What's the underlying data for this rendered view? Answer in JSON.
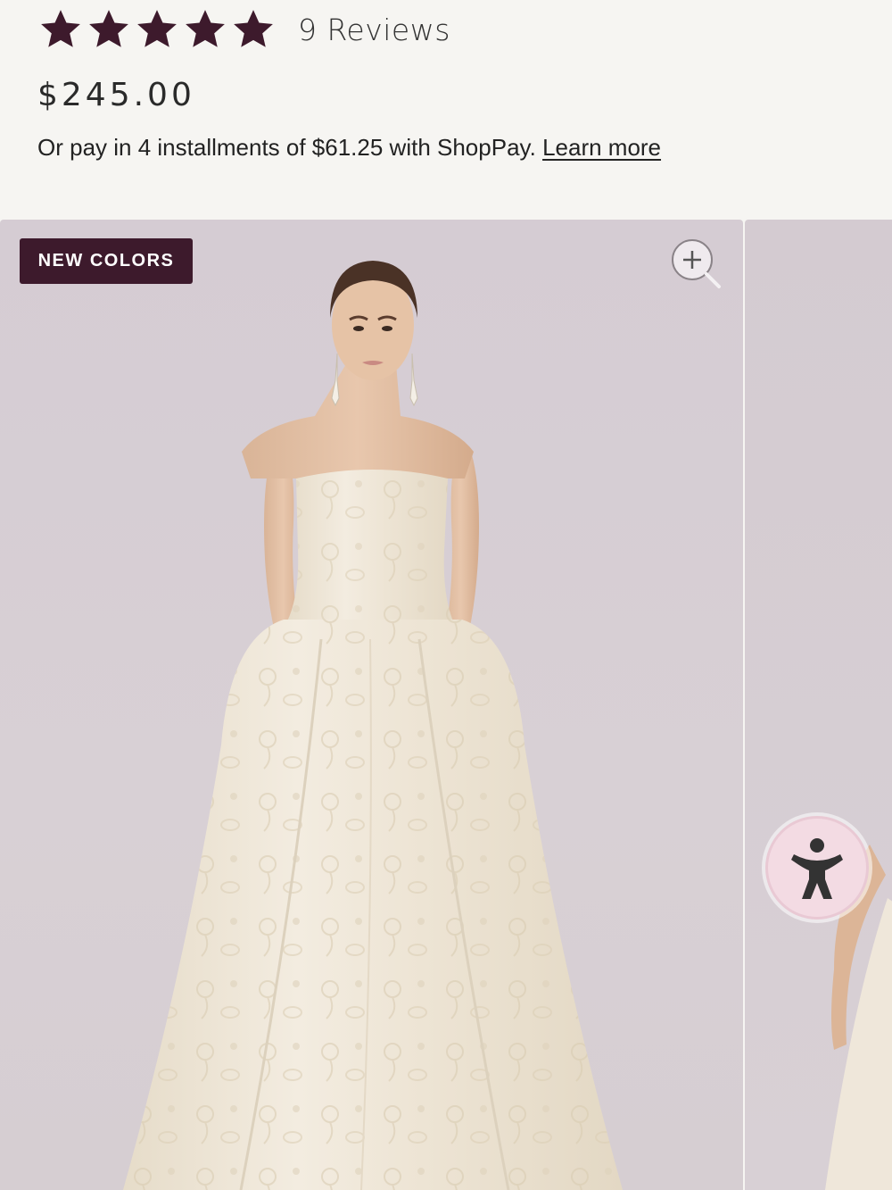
{
  "product": {
    "rating": 5,
    "reviews_label": "9 Reviews",
    "price": "$245.00",
    "installments_text": "Or pay in 4 installments of $61.25 with ShopPay.",
    "learn_more_label": "Learn more"
  },
  "gallery": {
    "badge_label": "NEW COLORS",
    "zoom_icon": "zoom-in-icon",
    "main_image_alt": "Model wearing strapless ivory floral jacquard ball gown",
    "accessibility_icon": "accessibility-icon"
  },
  "colors": {
    "star": "#3d1a2c",
    "badge_bg": "#3d1a2c",
    "page_bg": "#f6f5f2",
    "image_bg": "#d6ced3",
    "a11y_bg": "#f3dbe3"
  }
}
